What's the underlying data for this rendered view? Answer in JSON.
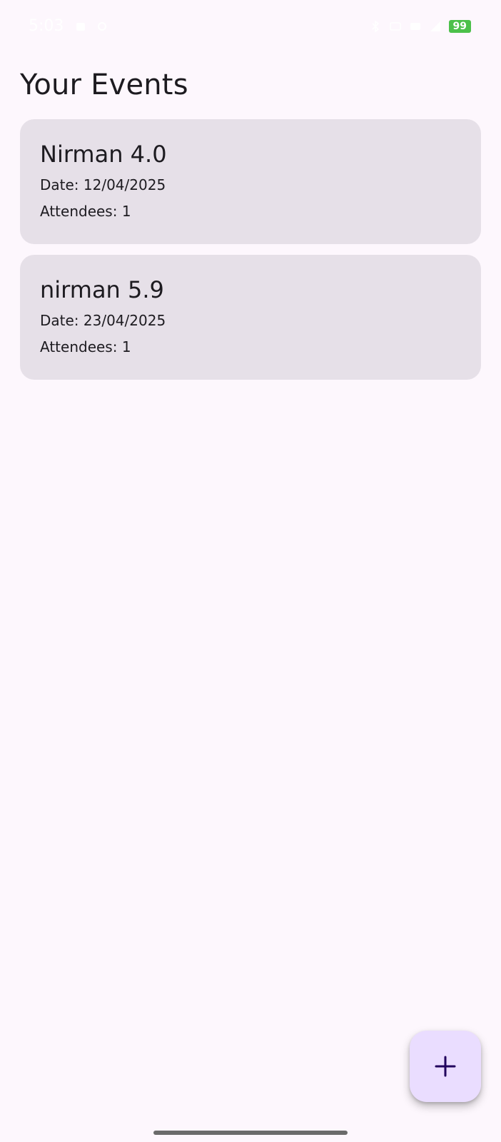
{
  "status_bar": {
    "time": "5:03",
    "battery": "99",
    "left_icons": [
      "notification-icon",
      "location-icon"
    ],
    "right_icons": [
      "bluetooth-icon",
      "data-icon",
      "data-icon-2",
      "signal-icon"
    ]
  },
  "page": {
    "title": "Your Events"
  },
  "events": [
    {
      "name": "Nirman 4.0",
      "date": "Date: 12/04/2025",
      "attendees": "Attendees: 1"
    },
    {
      "name": "nirman 5.9",
      "date": "Date: 23/04/2025",
      "attendees": "Attendees: 1"
    }
  ],
  "fab": {
    "icon": "plus-icon"
  },
  "colors": {
    "background": "#fdf7fd",
    "card": "#e6e0e8",
    "fab": "#eaddff",
    "fab_icon": "#21005d",
    "battery": "#4cc04a"
  }
}
